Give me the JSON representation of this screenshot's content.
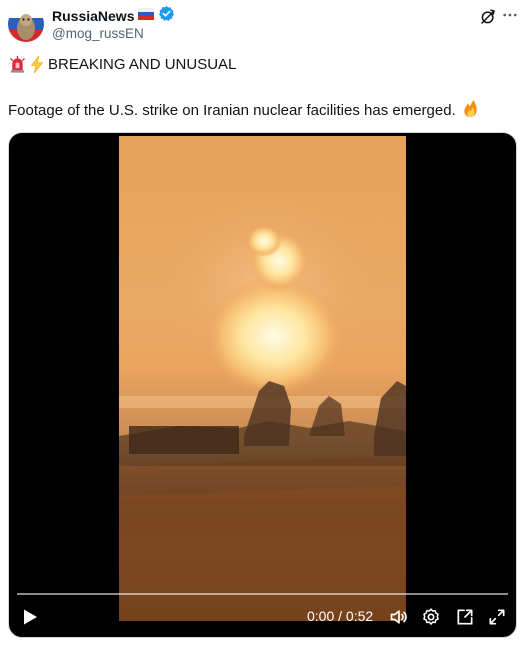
{
  "author": {
    "display_name": "RussiaNews",
    "handle": "@mog_russEN",
    "flag_icon": "russia-flag-icon",
    "verified_icon": "verified-badge-icon",
    "verified_color": "#1d9bf0"
  },
  "post": {
    "headline": "BREAKING AND UNUSUAL",
    "headline_icons": [
      "siren-emoji-icon",
      "lightning-emoji-icon"
    ],
    "text": "Footage of the U.S. strike on Iranian nuclear facilities has emerged.",
    "text_icon": "fire-emoji-icon"
  },
  "video": {
    "current_time": "0:00",
    "separator": " / ",
    "duration": "0:52",
    "progress": 0
  },
  "colors": {
    "text": "#0f1419",
    "secondary": "#536471",
    "video_bg": "#000000"
  }
}
